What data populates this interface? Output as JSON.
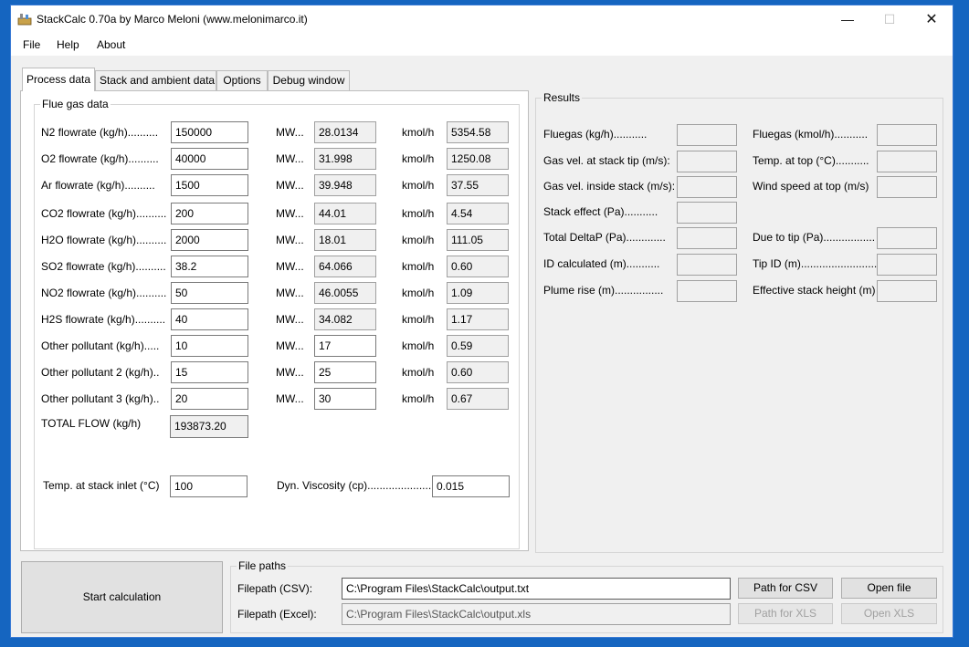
{
  "window": {
    "title": "StackCalc 0.70a by Marco Meloni (www.melonimarco.it)"
  },
  "menu": [
    "File",
    "Help",
    "About"
  ],
  "tabs": [
    "Process data",
    "Stack and ambient data",
    "Options",
    "Debug window"
  ],
  "flue": {
    "title": "Flue gas data",
    "mw_label": "MW...",
    "kmol_label": "kmol/h",
    "rows": [
      {
        "label": "N2 flowrate (kg/h)..........",
        "flow": "150000",
        "mw": "28.0134",
        "kmol": "5354.58"
      },
      {
        "label": "O2 flowrate (kg/h)..........",
        "flow": "40000",
        "mw": "31.998",
        "kmol": "1250.08"
      },
      {
        "label": "Ar flowrate (kg/h)..........",
        "flow": "1500",
        "mw": "39.948",
        "kmol": "37.55"
      },
      {
        "label": "CO2 flowrate (kg/h)..........",
        "flow": "200",
        "mw": "44.01",
        "kmol": "4.54"
      },
      {
        "label": "H2O flowrate (kg/h)..........",
        "flow": "2000",
        "mw": "18.01",
        "kmol": "111.05"
      },
      {
        "label": "SO2 flowrate (kg/h)..........",
        "flow": "38.2",
        "mw": "64.066",
        "kmol": "0.60"
      },
      {
        "label": "NO2 flowrate (kg/h)..........",
        "flow": "50",
        "mw": "46.0055",
        "kmol": "1.09"
      },
      {
        "label": "H2S flowrate (kg/h)..........",
        "flow": "40",
        "mw": "34.082",
        "kmol": "1.17"
      },
      {
        "label": "Other pollutant (kg/h).....",
        "flow": "10",
        "mw": "17",
        "kmol": "0.59"
      },
      {
        "label": "Other pollutant 2 (kg/h)..",
        "flow": "15",
        "mw": "25",
        "kmol": "0.60"
      },
      {
        "label": "Other pollutant 3 (kg/h)..",
        "flow": "20",
        "mw": "30",
        "kmol": "0.67"
      }
    ],
    "total_label": "TOTAL FLOW (kg/h)",
    "total_value": "193873.20",
    "temp_label": "Temp. at stack inlet (°C)",
    "temp_value": "100",
    "visc_label": "Dyn. Viscosity (cp)......................",
    "visc_value": "0.015"
  },
  "results": {
    "title": "Results",
    "left": [
      "Fluegas (kg/h)...........",
      "Gas vel. at stack tip (m/s):",
      "Gas vel. inside stack (m/s):",
      "Stack effect (Pa)...........",
      "Total DeltaP (Pa).............",
      "ID calculated (m)...........",
      "Plume rise (m)................"
    ],
    "right": [
      "Fluegas (kmol/h)...........",
      "Temp. at top (°C)...........",
      "Wind speed at top (m/s)",
      "",
      "Due to tip (Pa).................",
      "Tip ID (m).........................",
      "Effective stack height (m)"
    ]
  },
  "start_button": "Start calculation",
  "file_paths": {
    "title": "File paths",
    "csv_label": "Filepath (CSV):",
    "csv_value": "C:\\Program Files\\StackCalc\\output.txt",
    "xls_label": "Filepath (Excel):",
    "xls_value": "C:\\Program Files\\StackCalc\\output.xls",
    "path_csv": "Path for CSV",
    "open_file": "Open file",
    "path_xls": "Path for XLS",
    "open_xls": "Open XLS"
  }
}
